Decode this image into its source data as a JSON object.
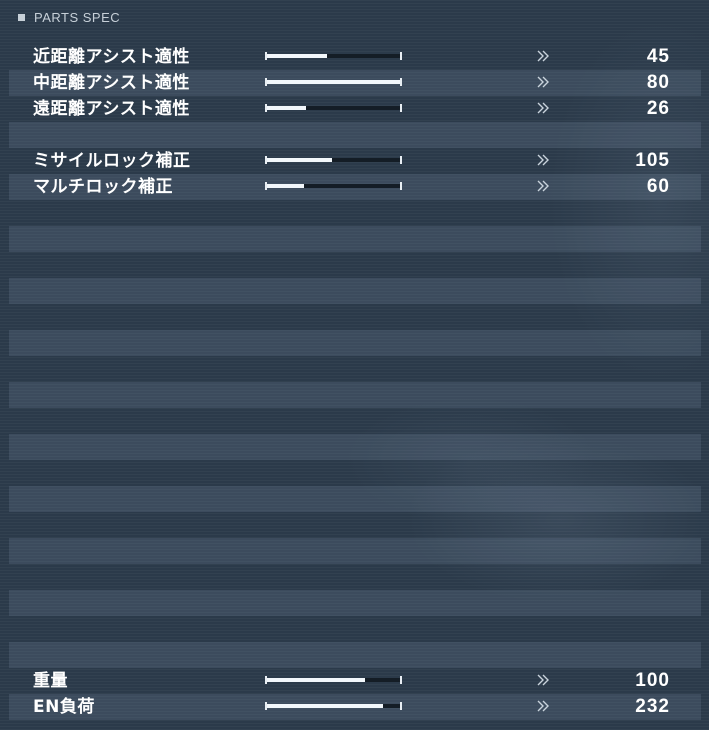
{
  "panel": {
    "title": "PARTS SPEC"
  },
  "rows": [
    {
      "label": "近距離アシスト適性",
      "value": "45",
      "level": 0.45,
      "shaded": false
    },
    {
      "label": "中距離アシスト適性",
      "value": "80",
      "level": 1.0,
      "shaded": true
    },
    {
      "label": "遠距離アシスト適性",
      "value": "26",
      "level": 0.29,
      "shaded": false
    },
    {
      "label": "",
      "value": "",
      "level": null,
      "shaded": true
    },
    {
      "label": "ミサイルロック補正",
      "value": "105",
      "level": 0.49,
      "shaded": false
    },
    {
      "label": "マルチロック補正",
      "value": "60",
      "level": 0.28,
      "shaded": true
    },
    {
      "label": "",
      "value": "",
      "level": null,
      "shaded": false
    },
    {
      "label": "",
      "value": "",
      "level": null,
      "shaded": true
    },
    {
      "label": "",
      "value": "",
      "level": null,
      "shaded": false
    },
    {
      "label": "",
      "value": "",
      "level": null,
      "shaded": true
    },
    {
      "label": "",
      "value": "",
      "level": null,
      "shaded": false
    },
    {
      "label": "",
      "value": "",
      "level": null,
      "shaded": true
    },
    {
      "label": "",
      "value": "",
      "level": null,
      "shaded": false
    },
    {
      "label": "",
      "value": "",
      "level": null,
      "shaded": true
    },
    {
      "label": "",
      "value": "",
      "level": null,
      "shaded": false
    },
    {
      "label": "",
      "value": "",
      "level": null,
      "shaded": true
    },
    {
      "label": "",
      "value": "",
      "level": null,
      "shaded": false
    },
    {
      "label": "",
      "value": "",
      "level": null,
      "shaded": true
    },
    {
      "label": "",
      "value": "",
      "level": null,
      "shaded": false
    },
    {
      "label": "",
      "value": "",
      "level": null,
      "shaded": true
    },
    {
      "label": "",
      "value": "",
      "level": null,
      "shaded": false
    },
    {
      "label": "",
      "value": "",
      "level": null,
      "shaded": true
    },
    {
      "label": "",
      "value": "",
      "level": null,
      "shaded": false
    },
    {
      "label": "",
      "value": "",
      "level": null,
      "shaded": true
    },
    {
      "label": "重量",
      "value": "100",
      "level": 0.74,
      "shaded": false
    },
    {
      "label": "EN負荷",
      "value": "232",
      "level": 0.87,
      "shaded": true
    }
  ],
  "colors": {
    "background": "#2b3a4a",
    "bar_fill": "#f2f7fb",
    "bar_track": "#141d26",
    "header": "#c7d0d8"
  },
  "icons": {
    "header": "square-bullet-icon",
    "row_separator": "double-chevron-right-icon"
  }
}
